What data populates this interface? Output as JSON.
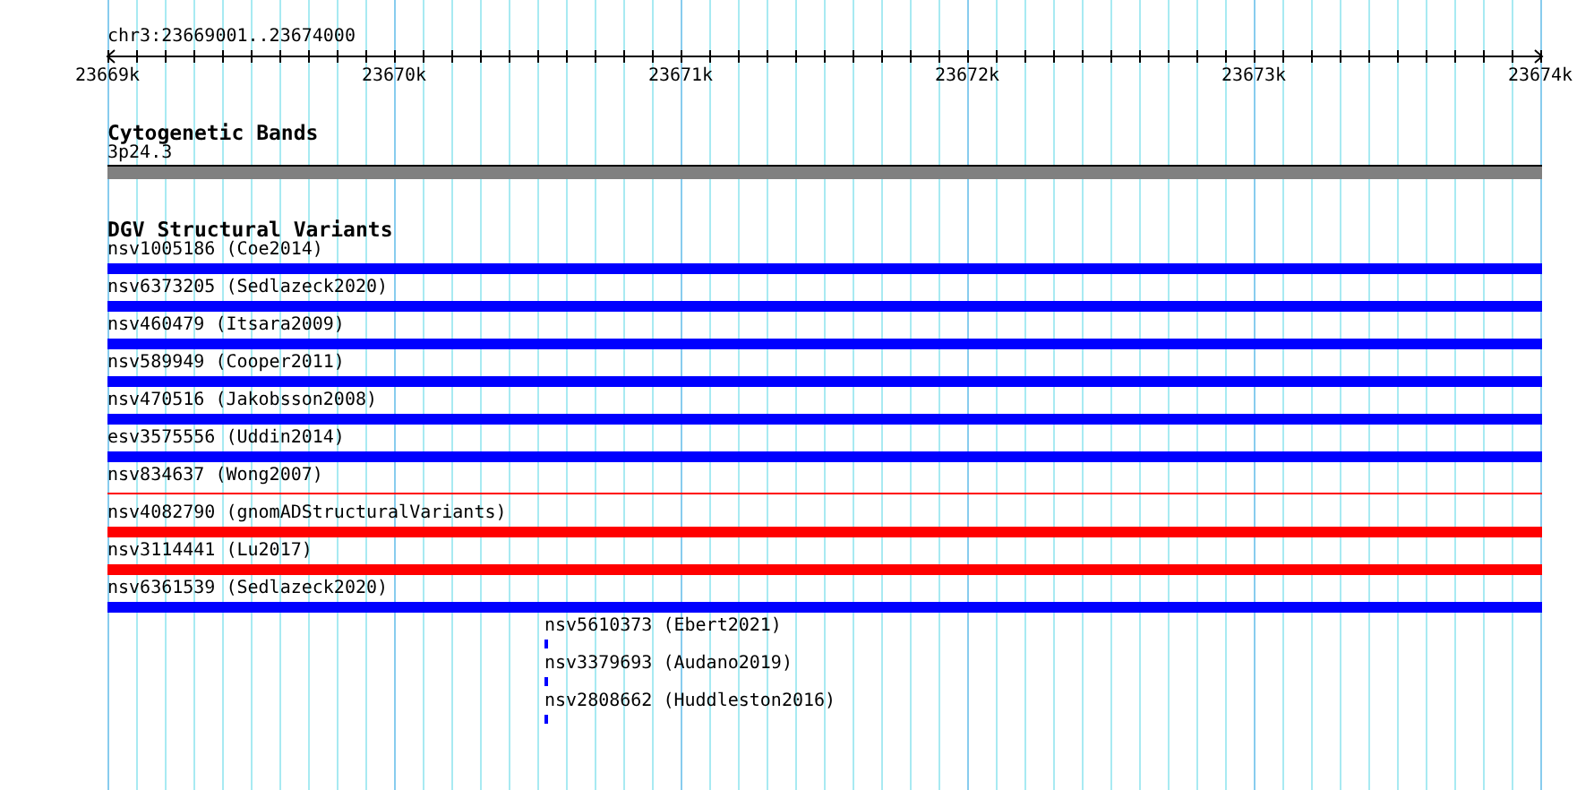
{
  "ruler": {
    "range": "chr3:23669001..23674000",
    "ticks": [
      "23669k",
      "23670k",
      "23671k",
      "23672k",
      "23673k",
      "23674k"
    ]
  },
  "tracks": [
    {
      "title": "Cytogenetic Bands",
      "features": [
        {
          "label": "3p24.3",
          "kind": "band"
        }
      ]
    },
    {
      "title": "DGV Structural Variants",
      "features": [
        {
          "label": "nsv1005186 (Coe2014)",
          "kind": "bar",
          "color": "#0000ff"
        },
        {
          "label": "nsv6373205 (Sedlazeck2020)",
          "kind": "bar",
          "color": "#0000ff"
        },
        {
          "label": "nsv460479 (Itsara2009)",
          "kind": "bar",
          "color": "#0000ff"
        },
        {
          "label": "nsv589949 (Cooper2011)",
          "kind": "bar",
          "color": "#0000ff"
        },
        {
          "label": "nsv470516 (Jakobsson2008)",
          "kind": "bar",
          "color": "#0000ff"
        },
        {
          "label": "esv3575556 (Uddin2014)",
          "kind": "bar",
          "color": "#0000ff"
        },
        {
          "label": "nsv834637 (Wong2007)",
          "kind": "line",
          "color": "#ff0000"
        },
        {
          "label": "nsv4082790 (gnomADStructuralVariants)",
          "kind": "bar",
          "color": "#ff0000"
        },
        {
          "label": "nsv3114441 (Lu2017)",
          "kind": "bar",
          "color": "#ff0000"
        },
        {
          "label": "nsv6361539 (Sedlazeck2020)",
          "kind": "bar",
          "color": "#0000ff"
        },
        {
          "label": "nsv5610373 (Ebert2021)",
          "kind": "mark",
          "color": "#0000ff"
        },
        {
          "label": "nsv3379693 (Audano2019)",
          "kind": "mark",
          "color": "#0000ff"
        },
        {
          "label": "nsv2808662 (Huddleston2016)",
          "kind": "mark",
          "color": "#0000ff"
        }
      ]
    }
  ]
}
